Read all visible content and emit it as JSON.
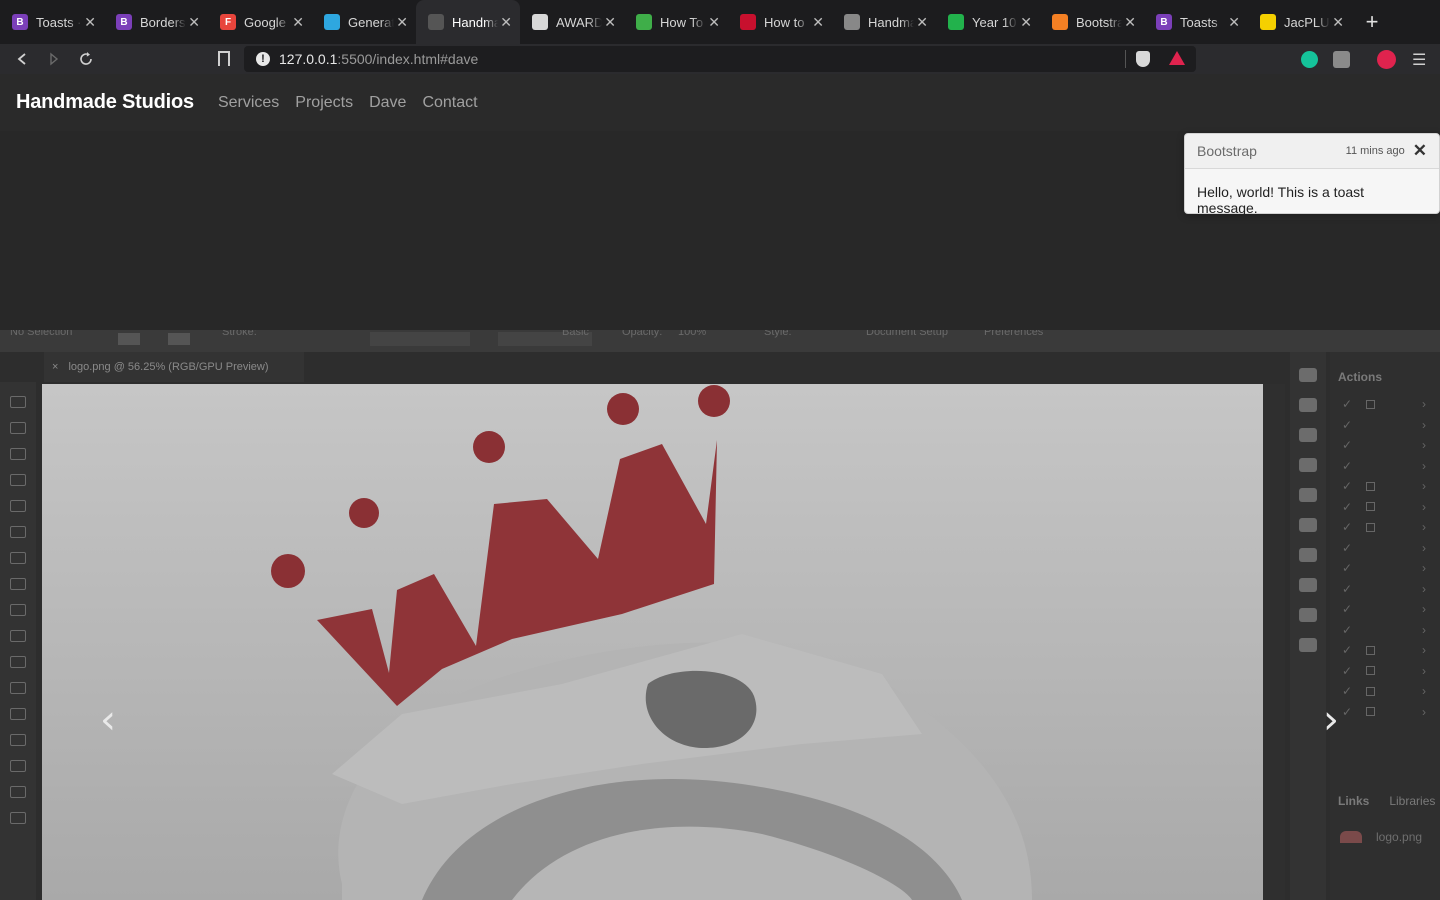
{
  "browser": {
    "tabs": [
      {
        "title": "Toasts · Bootstrap",
        "favicon_letter": "B",
        "favicon_color": "#7b3fb9",
        "active": false
      },
      {
        "title": "Borders",
        "favicon_letter": "B",
        "favicon_color": "#7b3fb9",
        "active": false
      },
      {
        "title": "Google Fonts",
        "favicon_letter": "F",
        "favicon_color": "#e8453c",
        "active": false
      },
      {
        "title": "Generate",
        "favicon_letter": "",
        "favicon_color": "#2ea7e0",
        "active": false
      },
      {
        "title": "Handmade",
        "favicon_letter": "",
        "favicon_color": "#555555",
        "active": true
      },
      {
        "title": "AWARDS",
        "favicon_letter": "",
        "favicon_color": "#d8d8d8",
        "active": false
      },
      {
        "title": "How To",
        "favicon_letter": "",
        "favicon_color": "#3fae49",
        "active": false
      },
      {
        "title": "How to",
        "favicon_letter": "",
        "favicon_color": "#c8102e",
        "active": false
      },
      {
        "title": "Handmade",
        "favicon_letter": "",
        "favicon_color": "#888888",
        "active": false
      },
      {
        "title": "Year 10",
        "favicon_letter": "",
        "favicon_color": "#22b24c",
        "active": false
      },
      {
        "title": "Bootstrap",
        "favicon_letter": "",
        "favicon_color": "#f48024",
        "active": false
      },
      {
        "title": "Toasts",
        "favicon_letter": "B",
        "favicon_color": "#7b3fb9",
        "active": false
      },
      {
        "title": "JacPLUS",
        "favicon_letter": "",
        "favicon_color": "#f5d000",
        "active": false
      }
    ],
    "new_tab_label": "+",
    "url_host": "127.0.0.1",
    "url_rest": ":5500/index.html#dave",
    "back_icon": "arrow-left-icon",
    "forward_icon": "arrow-right-icon",
    "reload_icon": "reload-icon"
  },
  "site": {
    "brand": "Handmade Studios",
    "nav": [
      "Services",
      "Projects",
      "Dave",
      "Contact"
    ]
  },
  "toast": {
    "title": "Bootstrap",
    "time": "11 mins ago",
    "close": "✕",
    "body": "Hello, world! This is a toast message."
  },
  "carousel": {
    "prev": "‹",
    "next": "›",
    "image": {
      "doc_title": "logo.png @ 56.25% (RGB/GPU Preview)",
      "toolbar_text": "No Selection",
      "toolbar_items": [
        "Stroke:",
        "Basic",
        "Opacity:",
        "100%",
        "Style:",
        "Document Setup",
        "Preferences"
      ],
      "actions_header": "Actions",
      "links_tab": "Links",
      "libraries_tab": "Libraries",
      "link_file": "logo.png"
    }
  }
}
